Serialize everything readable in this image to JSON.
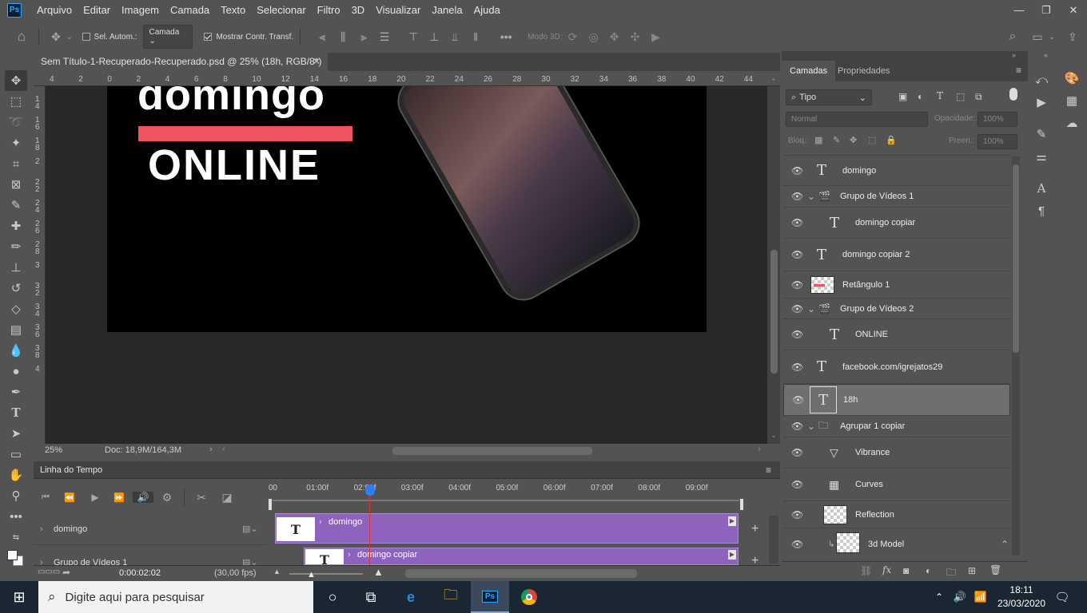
{
  "menubar": {
    "items": [
      "Arquivo",
      "Editar",
      "Imagem",
      "Camada",
      "Texto",
      "Selecionar",
      "Filtro",
      "3D",
      "Visualizar",
      "Janela",
      "Ajuda"
    ],
    "logo": "Ps"
  },
  "options": {
    "sel_autom": "Sel. Autom.:",
    "camada": "Camada",
    "mostrar": "Mostrar Contr. Transf.",
    "modo3d": "Modo 3D:"
  },
  "document": {
    "tab_title": "Sem Título-1-Recuperado-Recuperado.psd @ 25% (18h, RGB/8*)",
    "zoom": "25%",
    "doc_info": "Doc: 18,9M/164,3M"
  },
  "canvas": {
    "text1": "domingo",
    "text2": "ONLINE",
    "bar_color": "#ef5360"
  },
  "ruler_h": [
    "4",
    "2",
    "0",
    "2",
    "4",
    "6",
    "8",
    "10",
    "12",
    "14",
    "16",
    "18",
    "20",
    "22",
    "24",
    "26",
    "28",
    "30",
    "32",
    "34",
    "36",
    "38",
    "40",
    "42",
    "44"
  ],
  "ruler_v": [
    "1\n4",
    "1\n6",
    "1\n8",
    "2",
    "2\n2",
    "2\n4",
    "2\n6",
    "2\n8",
    "3",
    "3\n2",
    "3\n4",
    "3\n6",
    "3\n8",
    "4"
  ],
  "timeline": {
    "title": "Linha do Tempo",
    "ticks": [
      "00",
      "01:00f",
      "02:00f",
      "03:00f",
      "04:00f",
      "05:00f",
      "06:00f",
      "07:00f",
      "08:00f",
      "09:00f"
    ],
    "track1_name": "domingo",
    "track1_clip": "domingo",
    "track2_name": "Grupo de Vídeos 1",
    "track2_clip": "domingo copiar",
    "timecode": "0:00:02:02",
    "fps": "(30,00 fps)"
  },
  "layers_panel": {
    "tab_layers": "Camadas",
    "tab_props": "Propriedades",
    "filter": "Tipo",
    "blend": "Normal",
    "opacity_label": "Opacidade:",
    "opacity_value": "100%",
    "lock_label": "Bloq.:",
    "fill_label": "Preen.:",
    "fill_value": "100%",
    "layers": [
      {
        "name": "domingo",
        "type": "text"
      },
      {
        "name": "Grupo de Vídeos 1",
        "type": "videogroup"
      },
      {
        "name": "domingo copiar",
        "type": "text"
      },
      {
        "name": "domingo copiar 2",
        "type": "text"
      },
      {
        "name": "Retângulo 1",
        "type": "shape"
      },
      {
        "name": "Grupo de Vídeos 2",
        "type": "videogroup"
      },
      {
        "name": "ONLINE",
        "type": "text"
      },
      {
        "name": "facebook.com/igrejatos29",
        "type": "text"
      },
      {
        "name": "18h",
        "type": "text",
        "selected": true
      },
      {
        "name": "Agrupar 1 copiar",
        "type": "folder"
      },
      {
        "name": "Vibrance",
        "type": "adjustment"
      },
      {
        "name": "Curves",
        "type": "adjustment"
      },
      {
        "name": "Reflection",
        "type": "smart"
      },
      {
        "name": "3d Model",
        "type": "smart"
      }
    ]
  },
  "taskbar": {
    "search_placeholder": "Digite aqui para pesquisar",
    "time": "18:11",
    "date": "23/03/2020"
  }
}
